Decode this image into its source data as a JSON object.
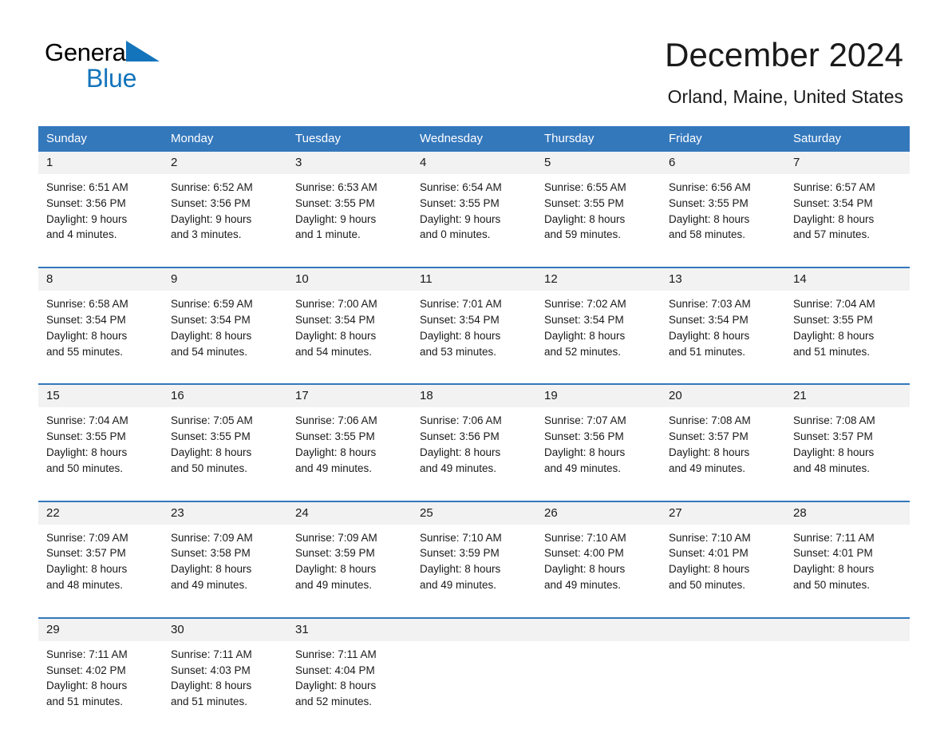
{
  "brand": {
    "name_part1": "General",
    "name_part2": "Blue",
    "triangle_icon": "blue-triangle-icon",
    "blue": "#1474bb"
  },
  "header": {
    "month_title": "December 2024",
    "location": "Orland, Maine, United States"
  },
  "theme": {
    "header_blue": "#3478bc",
    "daynum_gray": "#f2f2f2",
    "text": "#1a1a1a"
  },
  "calendar": {
    "weekday_headers": [
      "Sunday",
      "Monday",
      "Tuesday",
      "Wednesday",
      "Thursday",
      "Friday",
      "Saturday"
    ],
    "weeks": [
      [
        {
          "day": "1",
          "sunrise": "Sunrise: 6:51 AM",
          "sunset": "Sunset: 3:56 PM",
          "daylight1": "Daylight: 9 hours",
          "daylight2": "and 4 minutes."
        },
        {
          "day": "2",
          "sunrise": "Sunrise: 6:52 AM",
          "sunset": "Sunset: 3:56 PM",
          "daylight1": "Daylight: 9 hours",
          "daylight2": "and 3 minutes."
        },
        {
          "day": "3",
          "sunrise": "Sunrise: 6:53 AM",
          "sunset": "Sunset: 3:55 PM",
          "daylight1": "Daylight: 9 hours",
          "daylight2": "and 1 minute."
        },
        {
          "day": "4",
          "sunrise": "Sunrise: 6:54 AM",
          "sunset": "Sunset: 3:55 PM",
          "daylight1": "Daylight: 9 hours",
          "daylight2": "and 0 minutes."
        },
        {
          "day": "5",
          "sunrise": "Sunrise: 6:55 AM",
          "sunset": "Sunset: 3:55 PM",
          "daylight1": "Daylight: 8 hours",
          "daylight2": "and 59 minutes."
        },
        {
          "day": "6",
          "sunrise": "Sunrise: 6:56 AM",
          "sunset": "Sunset: 3:55 PM",
          "daylight1": "Daylight: 8 hours",
          "daylight2": "and 58 minutes."
        },
        {
          "day": "7",
          "sunrise": "Sunrise: 6:57 AM",
          "sunset": "Sunset: 3:54 PM",
          "daylight1": "Daylight: 8 hours",
          "daylight2": "and 57 minutes."
        }
      ],
      [
        {
          "day": "8",
          "sunrise": "Sunrise: 6:58 AM",
          "sunset": "Sunset: 3:54 PM",
          "daylight1": "Daylight: 8 hours",
          "daylight2": "and 55 minutes."
        },
        {
          "day": "9",
          "sunrise": "Sunrise: 6:59 AM",
          "sunset": "Sunset: 3:54 PM",
          "daylight1": "Daylight: 8 hours",
          "daylight2": "and 54 minutes."
        },
        {
          "day": "10",
          "sunrise": "Sunrise: 7:00 AM",
          "sunset": "Sunset: 3:54 PM",
          "daylight1": "Daylight: 8 hours",
          "daylight2": "and 54 minutes."
        },
        {
          "day": "11",
          "sunrise": "Sunrise: 7:01 AM",
          "sunset": "Sunset: 3:54 PM",
          "daylight1": "Daylight: 8 hours",
          "daylight2": "and 53 minutes."
        },
        {
          "day": "12",
          "sunrise": "Sunrise: 7:02 AM",
          "sunset": "Sunset: 3:54 PM",
          "daylight1": "Daylight: 8 hours",
          "daylight2": "and 52 minutes."
        },
        {
          "day": "13",
          "sunrise": "Sunrise: 7:03 AM",
          "sunset": "Sunset: 3:54 PM",
          "daylight1": "Daylight: 8 hours",
          "daylight2": "and 51 minutes."
        },
        {
          "day": "14",
          "sunrise": "Sunrise: 7:04 AM",
          "sunset": "Sunset: 3:55 PM",
          "daylight1": "Daylight: 8 hours",
          "daylight2": "and 51 minutes."
        }
      ],
      [
        {
          "day": "15",
          "sunrise": "Sunrise: 7:04 AM",
          "sunset": "Sunset: 3:55 PM",
          "daylight1": "Daylight: 8 hours",
          "daylight2": "and 50 minutes."
        },
        {
          "day": "16",
          "sunrise": "Sunrise: 7:05 AM",
          "sunset": "Sunset: 3:55 PM",
          "daylight1": "Daylight: 8 hours",
          "daylight2": "and 50 minutes."
        },
        {
          "day": "17",
          "sunrise": "Sunrise: 7:06 AM",
          "sunset": "Sunset: 3:55 PM",
          "daylight1": "Daylight: 8 hours",
          "daylight2": "and 49 minutes."
        },
        {
          "day": "18",
          "sunrise": "Sunrise: 7:06 AM",
          "sunset": "Sunset: 3:56 PM",
          "daylight1": "Daylight: 8 hours",
          "daylight2": "and 49 minutes."
        },
        {
          "day": "19",
          "sunrise": "Sunrise: 7:07 AM",
          "sunset": "Sunset: 3:56 PM",
          "daylight1": "Daylight: 8 hours",
          "daylight2": "and 49 minutes."
        },
        {
          "day": "20",
          "sunrise": "Sunrise: 7:08 AM",
          "sunset": "Sunset: 3:57 PM",
          "daylight1": "Daylight: 8 hours",
          "daylight2": "and 49 minutes."
        },
        {
          "day": "21",
          "sunrise": "Sunrise: 7:08 AM",
          "sunset": "Sunset: 3:57 PM",
          "daylight1": "Daylight: 8 hours",
          "daylight2": "and 48 minutes."
        }
      ],
      [
        {
          "day": "22",
          "sunrise": "Sunrise: 7:09 AM",
          "sunset": "Sunset: 3:57 PM",
          "daylight1": "Daylight: 8 hours",
          "daylight2": "and 48 minutes."
        },
        {
          "day": "23",
          "sunrise": "Sunrise: 7:09 AM",
          "sunset": "Sunset: 3:58 PM",
          "daylight1": "Daylight: 8 hours",
          "daylight2": "and 49 minutes."
        },
        {
          "day": "24",
          "sunrise": "Sunrise: 7:09 AM",
          "sunset": "Sunset: 3:59 PM",
          "daylight1": "Daylight: 8 hours",
          "daylight2": "and 49 minutes."
        },
        {
          "day": "25",
          "sunrise": "Sunrise: 7:10 AM",
          "sunset": "Sunset: 3:59 PM",
          "daylight1": "Daylight: 8 hours",
          "daylight2": "and 49 minutes."
        },
        {
          "day": "26",
          "sunrise": "Sunrise: 7:10 AM",
          "sunset": "Sunset: 4:00 PM",
          "daylight1": "Daylight: 8 hours",
          "daylight2": "and 49 minutes."
        },
        {
          "day": "27",
          "sunrise": "Sunrise: 7:10 AM",
          "sunset": "Sunset: 4:01 PM",
          "daylight1": "Daylight: 8 hours",
          "daylight2": "and 50 minutes."
        },
        {
          "day": "28",
          "sunrise": "Sunrise: 7:11 AM",
          "sunset": "Sunset: 4:01 PM",
          "daylight1": "Daylight: 8 hours",
          "daylight2": "and 50 minutes."
        }
      ],
      [
        {
          "day": "29",
          "sunrise": "Sunrise: 7:11 AM",
          "sunset": "Sunset: 4:02 PM",
          "daylight1": "Daylight: 8 hours",
          "daylight2": "and 51 minutes."
        },
        {
          "day": "30",
          "sunrise": "Sunrise: 7:11 AM",
          "sunset": "Sunset: 4:03 PM",
          "daylight1": "Daylight: 8 hours",
          "daylight2": "and 51 minutes."
        },
        {
          "day": "31",
          "sunrise": "Sunrise: 7:11 AM",
          "sunset": "Sunset: 4:04 PM",
          "daylight1": "Daylight: 8 hours",
          "daylight2": "and 52 minutes."
        },
        {
          "day": "",
          "sunrise": "",
          "sunset": "",
          "daylight1": "",
          "daylight2": ""
        },
        {
          "day": "",
          "sunrise": "",
          "sunset": "",
          "daylight1": "",
          "daylight2": ""
        },
        {
          "day": "",
          "sunrise": "",
          "sunset": "",
          "daylight1": "",
          "daylight2": ""
        },
        {
          "day": "",
          "sunrise": "",
          "sunset": "",
          "daylight1": "",
          "daylight2": ""
        }
      ]
    ]
  }
}
